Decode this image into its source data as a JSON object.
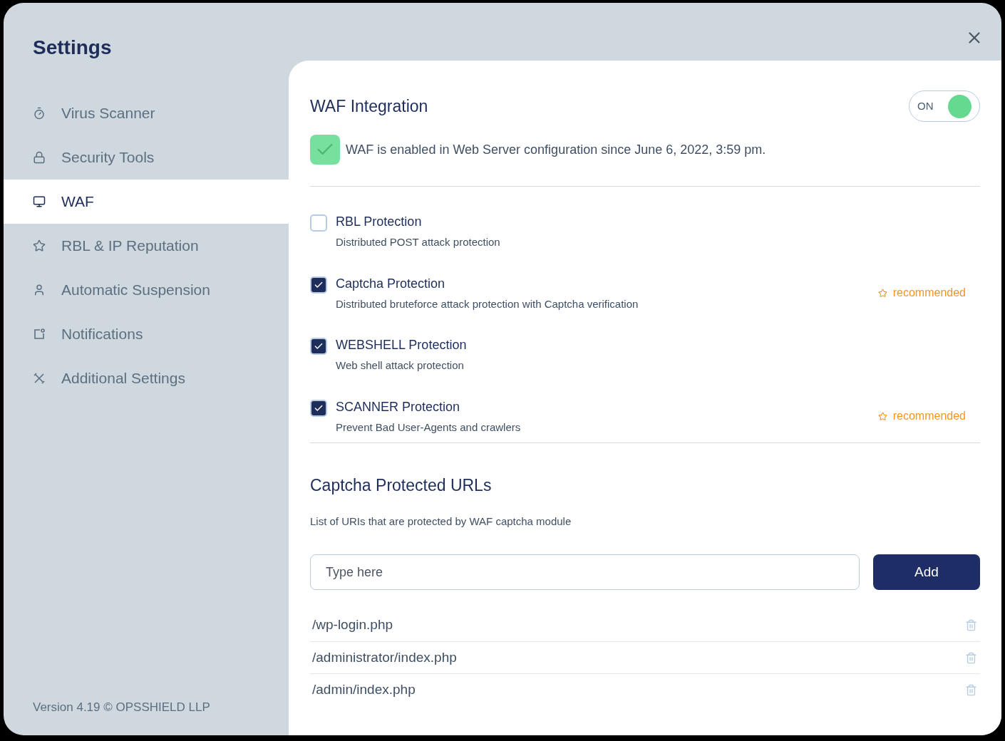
{
  "window": {
    "title": "Settings"
  },
  "sidebar": {
    "items": [
      {
        "label": "Virus Scanner",
        "selected": false
      },
      {
        "label": "Security Tools",
        "selected": false
      },
      {
        "label": "WAF",
        "selected": true
      },
      {
        "label": "RBL & IP Reputation",
        "selected": false
      },
      {
        "label": "Automatic Suspension",
        "selected": false
      },
      {
        "label": "Notifications",
        "selected": false
      },
      {
        "label": "Additional Settings",
        "selected": false
      }
    ],
    "footer": "Version 4.19 © OPSSHIELD LLP"
  },
  "waf": {
    "title": "WAF Integration",
    "toggle": {
      "label": "ON",
      "on": true
    },
    "status": {
      "checked": true,
      "text": "WAF is enabled in Web Server configuration since June 6, 2022, 3:59 pm."
    }
  },
  "protections": [
    {
      "title": "RBL Protection",
      "description": "Distributed POST attack protection",
      "checked": false
    },
    {
      "title": "Captcha Protection",
      "description": "Distributed bruteforce attack protection with Captcha verification",
      "checked": true,
      "badge": "recommended"
    },
    {
      "title": "WEBSHELL Protection",
      "description": "Web shell attack protection",
      "checked": true
    },
    {
      "title": "SCANNER Protection",
      "description": "Prevent Bad User-Agents and crawlers",
      "checked": true,
      "badge": "recommended"
    }
  ],
  "captcha_urls": {
    "title": "Captcha Protected URLs",
    "description": "List of URIs that are protected by WAF captcha module",
    "input": {
      "placeholder": "Type here"
    },
    "button": "Add",
    "urls": [
      "/wp-login.php",
      "/administrator/index.php",
      "/admin/index.php"
    ]
  }
}
